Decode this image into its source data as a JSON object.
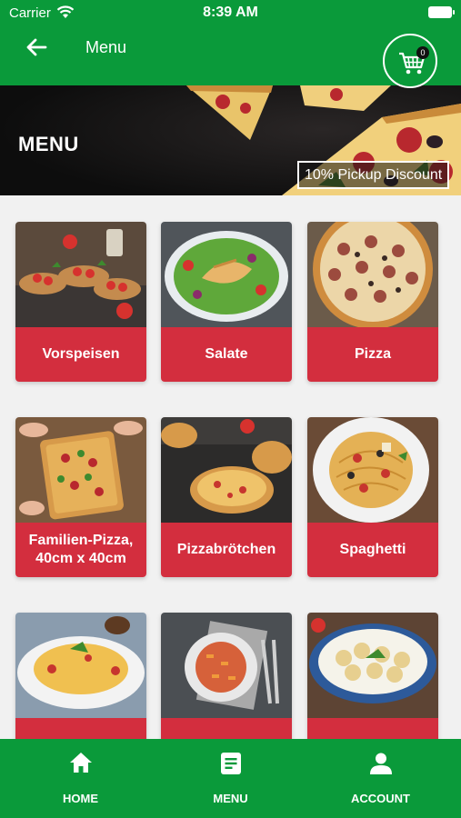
{
  "status_bar": {
    "carrier": "Carrier",
    "time": "8:39 AM"
  },
  "app_bar": {
    "title": "Menu",
    "cart_count": "0"
  },
  "banner": {
    "title": "MENU",
    "discount": "10% Pickup Discount"
  },
  "categories": [
    {
      "label": "Vorspeisen",
      "image": "bruschetta"
    },
    {
      "label": "Salate",
      "image": "chicken-salad"
    },
    {
      "label": "Pizza",
      "image": "salami-pizza"
    },
    {
      "label": "Familien-Pizza, 40cm x 40cm",
      "image": "family-pizza"
    },
    {
      "label": "Pizzabrötchen",
      "image": "pizza-rolls"
    },
    {
      "label": "Spaghetti",
      "image": "spaghetti-plate"
    },
    {
      "label": "",
      "image": "pasta-plate"
    },
    {
      "label": "",
      "image": "penne-plate"
    },
    {
      "label": "",
      "image": "tortellini-bowl"
    }
  ],
  "bottom_nav": [
    {
      "label": "HOME",
      "icon": "home-icon"
    },
    {
      "label": "MENU",
      "icon": "menu-list-icon"
    },
    {
      "label": "ACCOUNT",
      "icon": "account-icon"
    }
  ],
  "colors": {
    "primary_green": "#0a9a3a",
    "category_red": "#d32e3e"
  }
}
